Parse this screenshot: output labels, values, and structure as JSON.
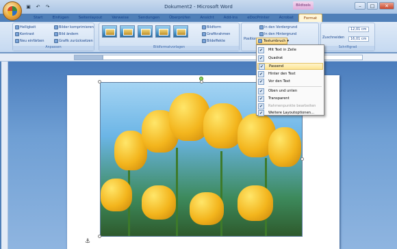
{
  "window": {
    "title": "Dokument2 - Microsoft Word",
    "context_group": "Bildtools"
  },
  "tabs": [
    "Start",
    "Einfügen",
    "Seitenlayout",
    "Verweise",
    "Sendungen",
    "Überprüfen",
    "Ansicht",
    "Add-Ins",
    "eDocPrinter",
    "Acrobat",
    "Format"
  ],
  "ribbon": {
    "adjust": {
      "items": [
        "Helligkeit",
        "Kontrast",
        "Neu einfärben",
        "Bilder komprimieren",
        "Bild ändern",
        "Grafik zurücksetzen"
      ],
      "label": "Anpassen"
    },
    "styles": {
      "label": "Bildformatvorlagen",
      "items": [
        "Bildform",
        "Grafikrahmen",
        "Bildeffekte"
      ]
    },
    "arrange": {
      "position_label": "Position",
      "items": [
        "In den Vordergrund",
        "In den Hintergrund",
        "Textumbruch"
      ]
    },
    "size": {
      "crop_label": "Zuschneiden",
      "height": "12,01 cm",
      "width": "16,01 cm",
      "label": "Schriftgrad"
    }
  },
  "wrap_menu": {
    "items": [
      {
        "label": "Mit Text in Zeile",
        "checked": false,
        "highlighted": false,
        "disabled": false
      },
      {
        "label": "Quadrat",
        "checked": false,
        "highlighted": false,
        "disabled": false
      },
      {
        "label": "Passend",
        "checked": true,
        "highlighted": true,
        "disabled": false
      },
      {
        "label": "Hinter den Text",
        "checked": false,
        "highlighted": false,
        "disabled": false
      },
      {
        "label": "Vor den Text",
        "checked": false,
        "highlighted": false,
        "disabled": false
      },
      {
        "label": "Oben und unten",
        "checked": false,
        "highlighted": false,
        "disabled": false
      },
      {
        "label": "Transparent",
        "checked": false,
        "highlighted": false,
        "disabled": false
      },
      {
        "label": "Rahmenpunkte bearbeiten",
        "checked": false,
        "highlighted": false,
        "disabled": true
      },
      {
        "label": "Weitere Layoutoptionen...",
        "checked": false,
        "highlighted": false,
        "disabled": false
      }
    ]
  },
  "colors": {
    "accent": "#fde491",
    "ribbon": "#c5d9f1",
    "workspace": "#6f9fd4"
  }
}
